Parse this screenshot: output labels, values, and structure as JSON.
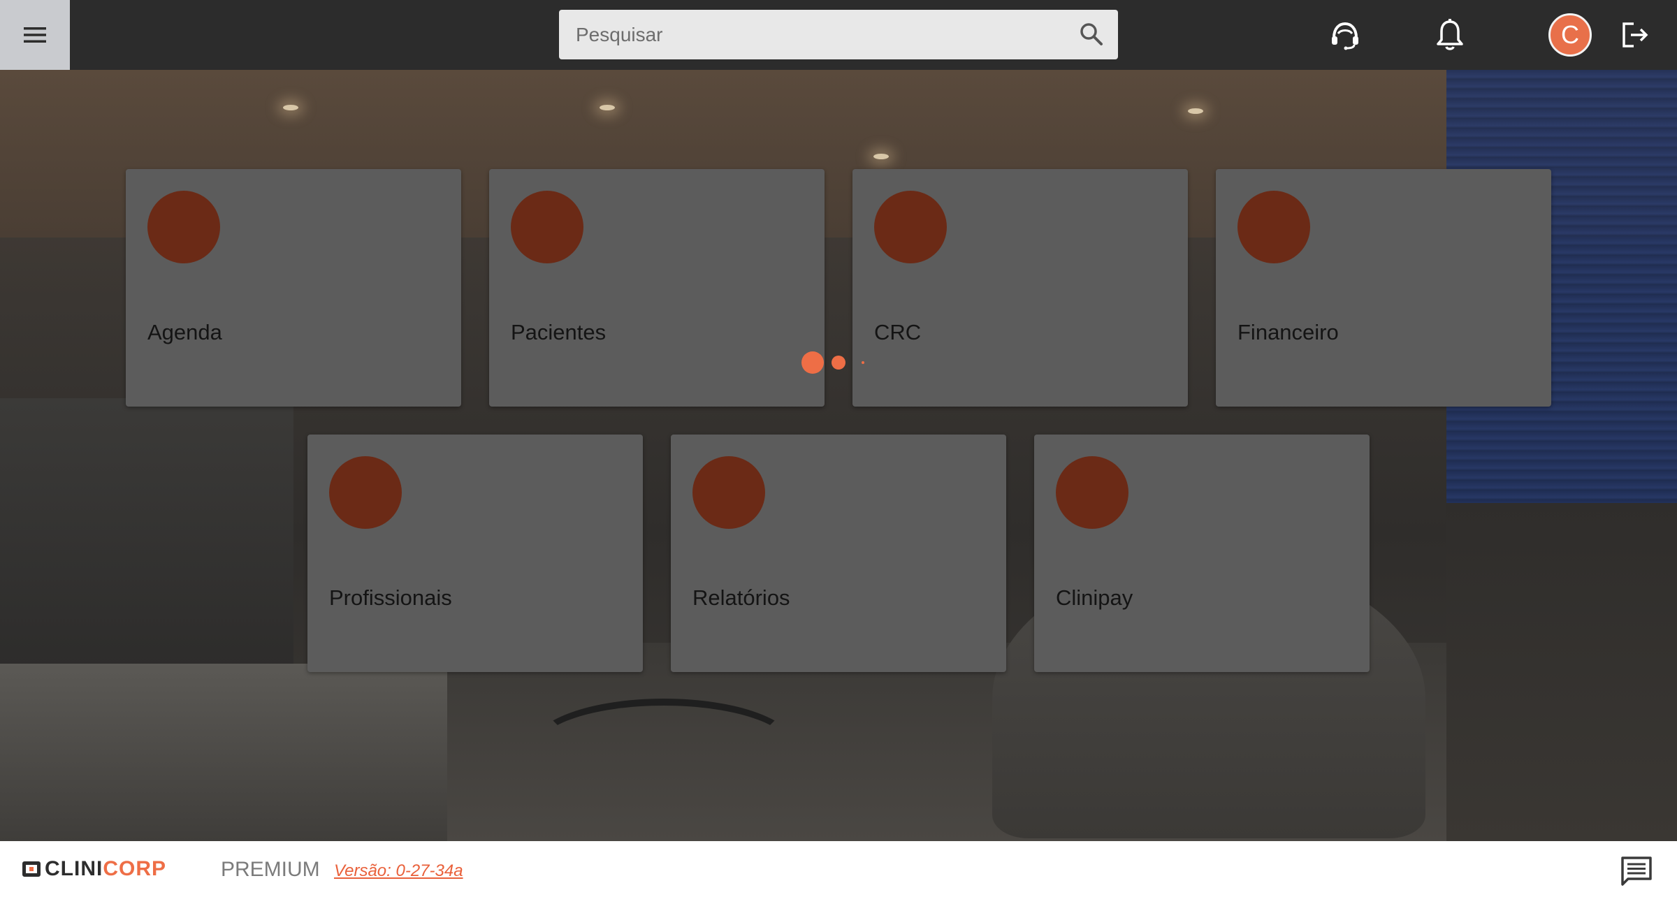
{
  "header": {
    "menu_icon": "hamburger-menu-icon",
    "search": {
      "placeholder": "Pesquisar",
      "value": "",
      "icon": "search-icon"
    },
    "icons": [
      "support-headset-icon",
      "notification-bell-icon",
      "logout-icon"
    ],
    "avatar": {
      "initial": "C",
      "color": "#e8704a"
    }
  },
  "modules": [
    {
      "label": "Agenda",
      "icon": "agenda-icon"
    },
    {
      "label": "Pacientes",
      "icon": "patients-icon"
    },
    {
      "label": "CRC",
      "icon": "crc-icon"
    },
    {
      "label": "Financeiro",
      "icon": "finance-icon"
    },
    {
      "label": "Profissionais",
      "icon": "professionals-icon"
    },
    {
      "label": "Relatórios",
      "icon": "reports-icon"
    },
    {
      "label": "Clinipay",
      "icon": "clinipay-icon"
    }
  ],
  "loader": {
    "state": "loading",
    "color": "#ee6e46"
  },
  "footer": {
    "brand_part1": "CLINI",
    "brand_part2": "CORP",
    "plan": "PREMIUM",
    "version": "Versão: 0-27-34a",
    "chat_icon": "chat-icon"
  },
  "colors": {
    "accent": "#ee6e46",
    "topbar": "#2c2c2c",
    "card": "#5c5c5c",
    "card_icon": "#6b2a16"
  }
}
